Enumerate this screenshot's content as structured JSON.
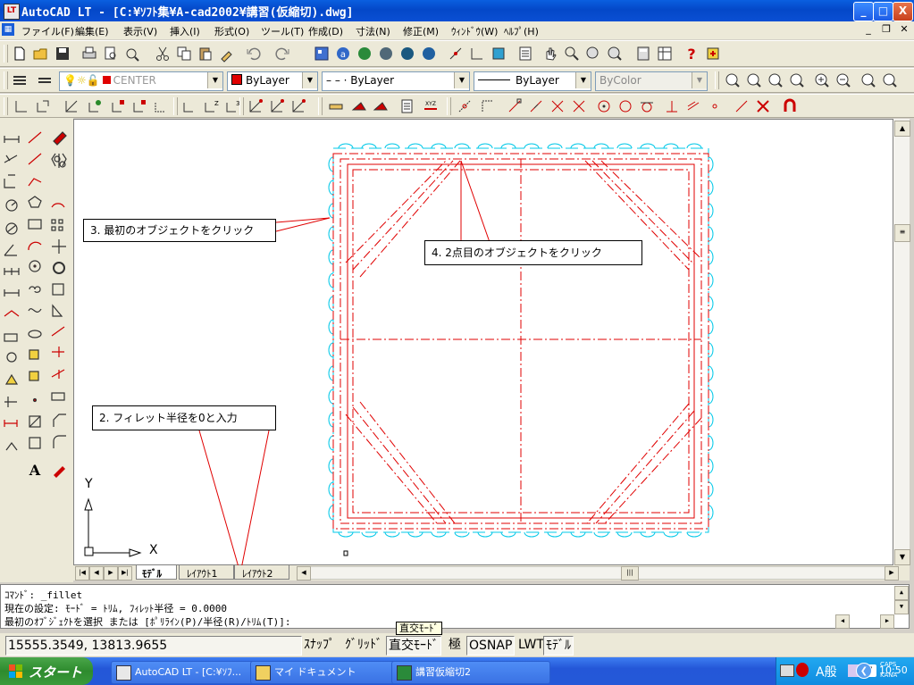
{
  "window": {
    "title": "AutoCAD LT - [C:¥ｿﾌﾄ集¥A-cad2002¥講習(仮縮切).dwg]",
    "controls": {
      "minimize": "_",
      "maximize": "□",
      "close": "X"
    }
  },
  "menu": {
    "items": [
      "ファイル(F)",
      "編集(E)",
      "表示(V)",
      "挿入(I)",
      "形式(O)",
      "ツール(T)",
      "作成(D)",
      "寸法(N)",
      "修正(M)",
      "ｳｨﾝﾄﾞｳ(W)",
      "ﾍﾙﾌﾟ(H)"
    ],
    "doc_controls": {
      "minimize": "_",
      "restore": "❐",
      "close": "✕"
    }
  },
  "layer_toolbar": {
    "layer_name": "CENTER",
    "color": "ByLayer",
    "linetype": "– – · ByLayer",
    "lineweight": "ByLayer",
    "plotstyle": "ByColor"
  },
  "drawing": {
    "ucs_x": "X",
    "ucs_y": "Y"
  },
  "callouts": {
    "c1": "3. 最初のオブジェクトをクリック",
    "c2": "4. 2点目のオブジェクトをクリック",
    "c3": "2. フィレット半径を0と入力"
  },
  "tabs": [
    "ﾓﾃﾞﾙ",
    "ﾚｲｱｳﾄ1",
    "ﾚｲｱｳﾄ2"
  ],
  "command": {
    "line1": "ｺﾏﾝﾄﾞ: _fillet",
    "line2": "現在の設定: ﾓｰﾄﾞ = ﾄﾘﾑ, ﾌｨﾚｯﾄ半径 = 0.0000",
    "line3": "最初のｵﾌﾞｼﾞｪｸﾄを選択 または [ﾎﾟﾘﾗｲﾝ(P)/半径(R)/ﾄﾘﾑ(T)]:"
  },
  "status": {
    "coords": "15555.3549, 13813.9655",
    "snap": "ｽﾅｯﾌﾟ",
    "grid": "ｸﾞﾘｯﾄﾞ",
    "ortho": "直交ﾓｰﾄﾞ",
    "polar": "極",
    "osnap": "OSNAP",
    "lwt": "LWT",
    "model": "ﾓﾃﾞﾙ",
    "tooltip": "直交ﾓｰﾄﾞ"
  },
  "taskbar": {
    "start": "スタート",
    "tasks": [
      "AutoCAD LT - [C:¥ｿﾌ...",
      "マイ ドキュメント",
      "講習仮縮切2"
    ],
    "ime": "A般",
    "caps": "CAPS",
    "kana": "KANA",
    "clock": "10:50"
  },
  "colors": {
    "title_bar": "#0a50d8",
    "drawing_red": "#e00000",
    "outline_cyan": "#00c8e8",
    "taskbar": "#2a5fd8",
    "start_green": "#3a9a3a"
  }
}
